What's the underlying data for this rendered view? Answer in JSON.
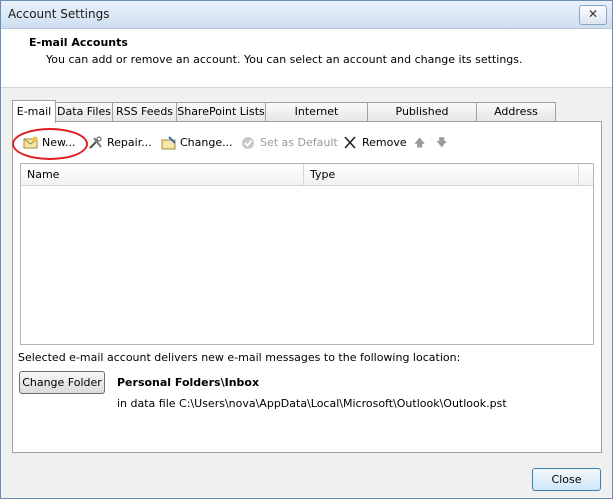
{
  "window": {
    "title": "Account Settings",
    "close_glyph": "✕"
  },
  "header": {
    "title": "E-mail Accounts",
    "description": "You can add or remove an account. You can select an account and change its settings."
  },
  "tabs": [
    {
      "label": "E-mail"
    },
    {
      "label": "Data Files"
    },
    {
      "label": "RSS Feeds"
    },
    {
      "label": "SharePoint Lists"
    },
    {
      "label": "Internet Calendars"
    },
    {
      "label": "Published Calendars"
    },
    {
      "label": "Address Books"
    }
  ],
  "toolbar": {
    "new_label": "New...",
    "repair_label": "Repair...",
    "change_label": "Change...",
    "set_default_label": "Set as Default",
    "remove_label": "Remove",
    "up_glyph": "🡅",
    "down_glyph": "🡇"
  },
  "list": {
    "columns": [
      "Name",
      "Type"
    ]
  },
  "delivery": {
    "text": "Selected e-mail account delivers new e-mail messages to the following location:",
    "change_folder_label": "Change Folder",
    "folder": "Personal Folders\\Inbox",
    "path": "in data file C:\\Users\\nova\\AppData\\Local\\Microsoft\\Outlook\\Outlook.pst"
  },
  "footer": {
    "close_label": "Close"
  },
  "colors": {
    "annotation_circle": "#e02020"
  }
}
